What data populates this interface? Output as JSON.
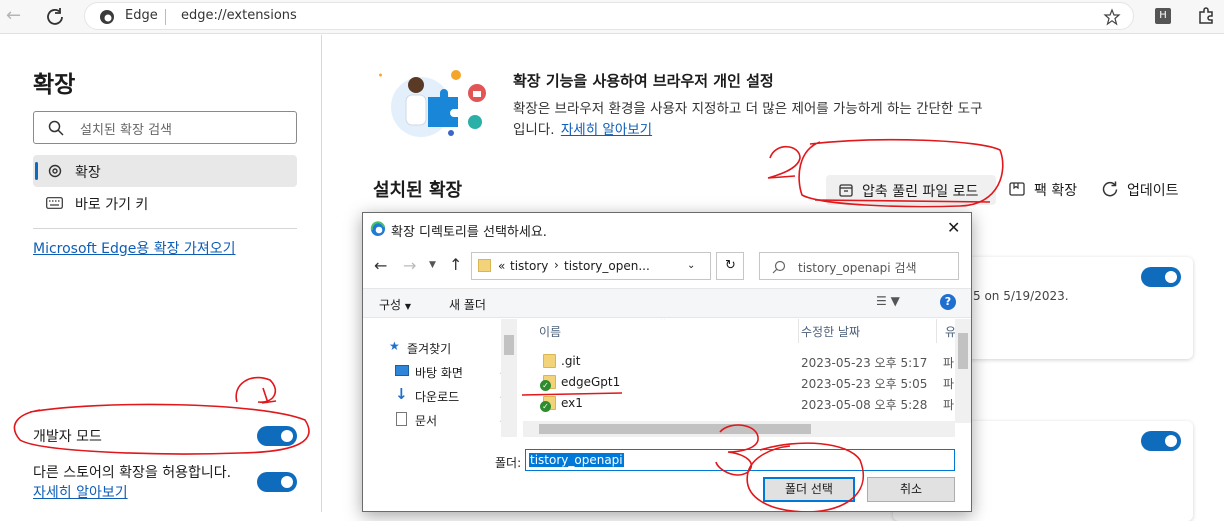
{
  "browser": {
    "brand": "Edge",
    "url": "edge://extensions",
    "profile_initial": "H"
  },
  "sidebar": {
    "title": "확장",
    "search_placeholder": "설치된 확장 검색",
    "items": [
      {
        "label": "확장",
        "active": true
      },
      {
        "label": "바로 가기 키",
        "active": false
      }
    ],
    "store_link": "Microsoft Edge용 확장 가져오기",
    "dev_mode_label": "개발자 모드",
    "dev_mode_on": true,
    "other_store_label": "다른 스토어의 확장을 허용합니다.",
    "other_store_link": "자세히 알아보기",
    "other_store_on": true
  },
  "main": {
    "promo_title": "확장 기능을 사용하여 브라우저 개인 설정",
    "promo_desc_line1": "확장은 브라우저 환경을 사용자 지정하고 더 많은 제어를 가능하게 하는 간단한 도구",
    "promo_desc_line2_prefix": "입니다.",
    "promo_link": "자세히 알아보기",
    "installed_heading": "설치된 확장",
    "actions": {
      "load_unpacked": "압축 풀린 파일 로드",
      "pack": "팩 확장",
      "update": "업데이트"
    },
    "card1_partial_text": "5 on 5/19/2023."
  },
  "dialog": {
    "title": "확장 디렉토리를 선택하세요.",
    "path_prefix": "«",
    "path": [
      "tistory",
      "tistory_open..."
    ],
    "search_placeholder": "tistory_openapi 검색",
    "organize": "구성",
    "new_folder": "새 폴더",
    "help": "?",
    "nav": [
      {
        "label": "즐겨찾기"
      },
      {
        "label": "바탕 화면"
      },
      {
        "label": "다운로드"
      },
      {
        "label": "문서"
      }
    ],
    "columns": {
      "name": "이름",
      "date": "수정한 날짜",
      "type": "유"
    },
    "files": [
      {
        "name": ".git",
        "date": "2023-05-23 오후 5:17",
        "type": "파",
        "sync": false
      },
      {
        "name": "edgeGpt1",
        "date": "2023-05-23 오후 5:05",
        "type": "파",
        "sync": true
      },
      {
        "name": "ex1",
        "date": "2023-05-08 오후 5:28",
        "type": "파",
        "sync": true
      }
    ],
    "folder_label": "폴더:",
    "folder_value": "tistory_openapi",
    "select_button": "폴더 선택",
    "cancel_button": "취소"
  },
  "annotations": [
    "1",
    "2",
    "3"
  ],
  "colors": {
    "accent": "#0f6cbd",
    "annotation": "#e0171b",
    "link": "#0f5eb6"
  }
}
